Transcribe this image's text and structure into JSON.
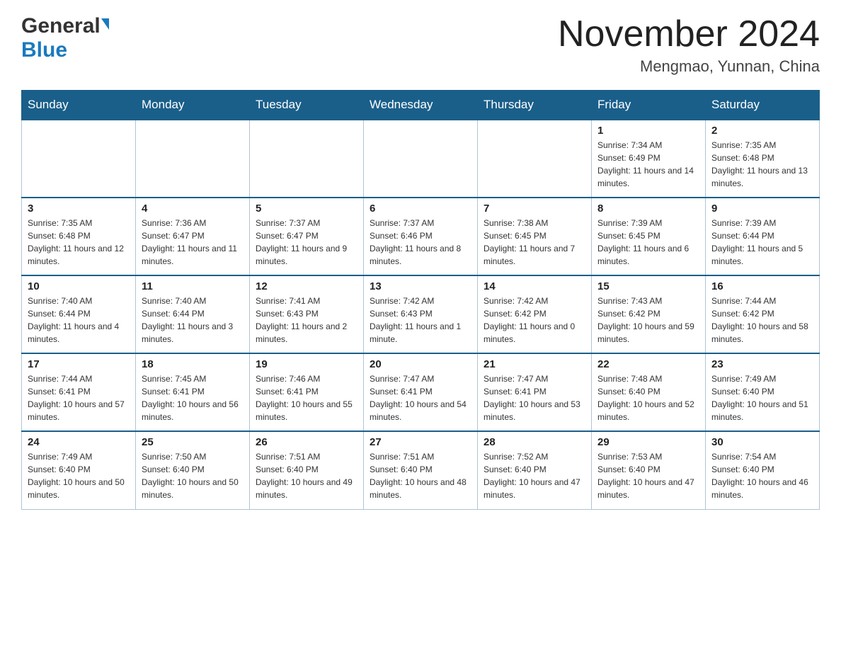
{
  "header": {
    "logo": {
      "general": "General",
      "blue": "Blue",
      "arrow": "▲"
    },
    "title": "November 2024",
    "location": "Mengmao, Yunnan, China"
  },
  "calendar": {
    "days": [
      "Sunday",
      "Monday",
      "Tuesday",
      "Wednesday",
      "Thursday",
      "Friday",
      "Saturday"
    ],
    "weeks": [
      [
        {
          "day": "",
          "info": ""
        },
        {
          "day": "",
          "info": ""
        },
        {
          "day": "",
          "info": ""
        },
        {
          "day": "",
          "info": ""
        },
        {
          "day": "",
          "info": ""
        },
        {
          "day": "1",
          "info": "Sunrise: 7:34 AM\nSunset: 6:49 PM\nDaylight: 11 hours and 14 minutes."
        },
        {
          "day": "2",
          "info": "Sunrise: 7:35 AM\nSunset: 6:48 PM\nDaylight: 11 hours and 13 minutes."
        }
      ],
      [
        {
          "day": "3",
          "info": "Sunrise: 7:35 AM\nSunset: 6:48 PM\nDaylight: 11 hours and 12 minutes."
        },
        {
          "day": "4",
          "info": "Sunrise: 7:36 AM\nSunset: 6:47 PM\nDaylight: 11 hours and 11 minutes."
        },
        {
          "day": "5",
          "info": "Sunrise: 7:37 AM\nSunset: 6:47 PM\nDaylight: 11 hours and 9 minutes."
        },
        {
          "day": "6",
          "info": "Sunrise: 7:37 AM\nSunset: 6:46 PM\nDaylight: 11 hours and 8 minutes."
        },
        {
          "day": "7",
          "info": "Sunrise: 7:38 AM\nSunset: 6:45 PM\nDaylight: 11 hours and 7 minutes."
        },
        {
          "day": "8",
          "info": "Sunrise: 7:39 AM\nSunset: 6:45 PM\nDaylight: 11 hours and 6 minutes."
        },
        {
          "day": "9",
          "info": "Sunrise: 7:39 AM\nSunset: 6:44 PM\nDaylight: 11 hours and 5 minutes."
        }
      ],
      [
        {
          "day": "10",
          "info": "Sunrise: 7:40 AM\nSunset: 6:44 PM\nDaylight: 11 hours and 4 minutes."
        },
        {
          "day": "11",
          "info": "Sunrise: 7:40 AM\nSunset: 6:44 PM\nDaylight: 11 hours and 3 minutes."
        },
        {
          "day": "12",
          "info": "Sunrise: 7:41 AM\nSunset: 6:43 PM\nDaylight: 11 hours and 2 minutes."
        },
        {
          "day": "13",
          "info": "Sunrise: 7:42 AM\nSunset: 6:43 PM\nDaylight: 11 hours and 1 minute."
        },
        {
          "day": "14",
          "info": "Sunrise: 7:42 AM\nSunset: 6:42 PM\nDaylight: 11 hours and 0 minutes."
        },
        {
          "day": "15",
          "info": "Sunrise: 7:43 AM\nSunset: 6:42 PM\nDaylight: 10 hours and 59 minutes."
        },
        {
          "day": "16",
          "info": "Sunrise: 7:44 AM\nSunset: 6:42 PM\nDaylight: 10 hours and 58 minutes."
        }
      ],
      [
        {
          "day": "17",
          "info": "Sunrise: 7:44 AM\nSunset: 6:41 PM\nDaylight: 10 hours and 57 minutes."
        },
        {
          "day": "18",
          "info": "Sunrise: 7:45 AM\nSunset: 6:41 PM\nDaylight: 10 hours and 56 minutes."
        },
        {
          "day": "19",
          "info": "Sunrise: 7:46 AM\nSunset: 6:41 PM\nDaylight: 10 hours and 55 minutes."
        },
        {
          "day": "20",
          "info": "Sunrise: 7:47 AM\nSunset: 6:41 PM\nDaylight: 10 hours and 54 minutes."
        },
        {
          "day": "21",
          "info": "Sunrise: 7:47 AM\nSunset: 6:41 PM\nDaylight: 10 hours and 53 minutes."
        },
        {
          "day": "22",
          "info": "Sunrise: 7:48 AM\nSunset: 6:40 PM\nDaylight: 10 hours and 52 minutes."
        },
        {
          "day": "23",
          "info": "Sunrise: 7:49 AM\nSunset: 6:40 PM\nDaylight: 10 hours and 51 minutes."
        }
      ],
      [
        {
          "day": "24",
          "info": "Sunrise: 7:49 AM\nSunset: 6:40 PM\nDaylight: 10 hours and 50 minutes."
        },
        {
          "day": "25",
          "info": "Sunrise: 7:50 AM\nSunset: 6:40 PM\nDaylight: 10 hours and 50 minutes."
        },
        {
          "day": "26",
          "info": "Sunrise: 7:51 AM\nSunset: 6:40 PM\nDaylight: 10 hours and 49 minutes."
        },
        {
          "day": "27",
          "info": "Sunrise: 7:51 AM\nSunset: 6:40 PM\nDaylight: 10 hours and 48 minutes."
        },
        {
          "day": "28",
          "info": "Sunrise: 7:52 AM\nSunset: 6:40 PM\nDaylight: 10 hours and 47 minutes."
        },
        {
          "day": "29",
          "info": "Sunrise: 7:53 AM\nSunset: 6:40 PM\nDaylight: 10 hours and 47 minutes."
        },
        {
          "day": "30",
          "info": "Sunrise: 7:54 AM\nSunset: 6:40 PM\nDaylight: 10 hours and 46 minutes."
        }
      ]
    ]
  }
}
